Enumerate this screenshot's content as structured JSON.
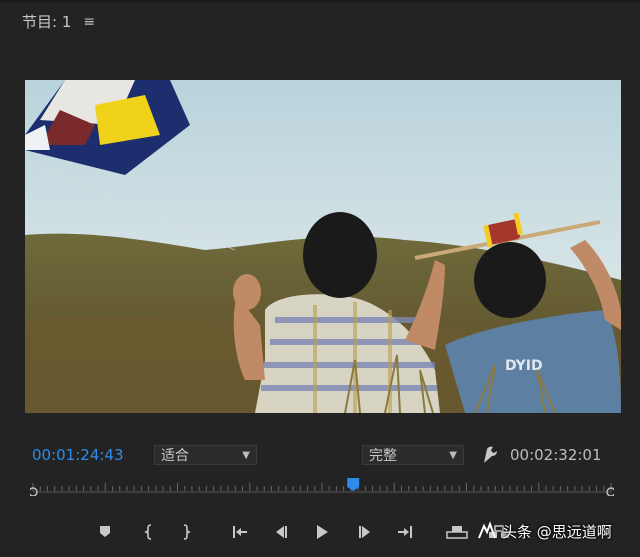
{
  "panel": {
    "title": "节目: 1",
    "menu_icon": "hamburger-icon"
  },
  "viewer": {
    "scene": "two boys flying a kite on a hillside"
  },
  "timecode": {
    "current": "00:01:24:43",
    "duration": "00:02:32:01"
  },
  "zoom_select": {
    "selected": "适合"
  },
  "resolution_select": {
    "selected": "完整"
  },
  "playhead": {
    "position_fraction": 0.554
  },
  "watermark": {
    "text": "头条 @思远道啊"
  },
  "colors": {
    "timecode": "#2d8ceb",
    "playhead": "#2d8ceb",
    "panel_bg": "#232323"
  },
  "transport_icons": [
    "add-marker-icon",
    "mark-in-icon",
    "mark-out-icon",
    "go-to-in-icon",
    "step-back-icon",
    "play-icon",
    "step-forward-icon",
    "go-to-out-icon",
    "lift-icon",
    "extract-icon",
    "export-frame-icon"
  ]
}
